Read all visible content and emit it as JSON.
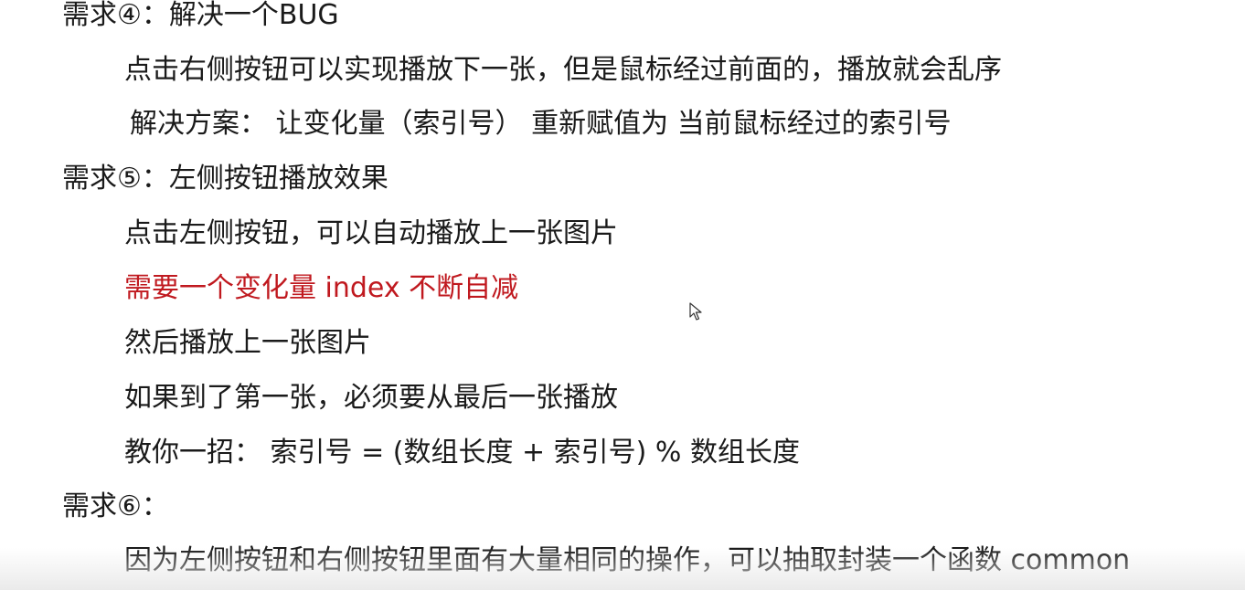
{
  "lines": [
    {
      "text": "需求④：解决一个BUG"
    },
    {
      "text": "点击右侧按钮可以实现播放下一张，但是鼠标经过前面的，播放就会乱序"
    },
    {
      "text": "解决方案：  让变化量（索引号） 重新赋值为 当前鼠标经过的索引号"
    },
    {
      "text": "需求⑤：左侧按钮播放效果"
    },
    {
      "text": "点击左侧按钮，可以自动播放上一张图片"
    },
    {
      "text": "需要一个变化量  index 不断自减"
    },
    {
      "text": "然后播放上一张图片"
    },
    {
      "text": "如果到了第一张，必须要从最后一张播放"
    },
    {
      "text": "教你一招：  索引号 =  (数组长度 + 索引号) %  数组长度"
    },
    {
      "text": "需求⑥："
    },
    {
      "text": "因为左侧按钮和右侧按钮里面有大量相同的操作，可以抽取封装一个函数 common"
    }
  ],
  "colors": {
    "text": "#1a1a1a",
    "highlight": "#c0191f",
    "background": "#ffffff"
  },
  "cursor_icon": "mouse-pointer-icon"
}
